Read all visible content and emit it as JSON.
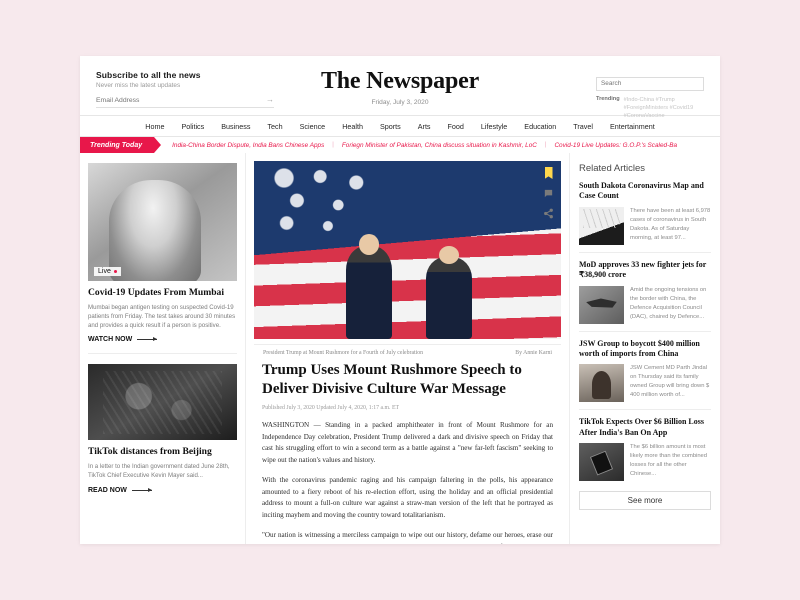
{
  "subscribe": {
    "title": "Subscribe to all the news",
    "subtitle": "Never miss the latest updates",
    "email_placeholder": "Email Address",
    "submit_arrow": "→"
  },
  "brand": {
    "title": "The Newspaper",
    "date": "Friday, July 3, 2020"
  },
  "search": {
    "placeholder": "Search",
    "trending_label": "Trending",
    "trending_tags": "#Indo-China #Trump #ForeignMinisters #Covid19 #CoronaVaccine"
  },
  "nav": {
    "items": [
      {
        "label": "Home"
      },
      {
        "label": "Politics"
      },
      {
        "label": "Business"
      },
      {
        "label": "Tech"
      },
      {
        "label": "Science"
      },
      {
        "label": "Health"
      },
      {
        "label": "Sports"
      },
      {
        "label": "Arts"
      },
      {
        "label": "Food"
      },
      {
        "label": "Lifestyle"
      },
      {
        "label": "Education"
      },
      {
        "label": "Travel"
      },
      {
        "label": "Entertainment"
      }
    ]
  },
  "ticker": {
    "badge": "Trending Today",
    "separator": "|",
    "items": [
      {
        "text": "India-China Border Dispute, India Bans Chinese Apps"
      },
      {
        "text": "Foriegn Minister of Pakistan, China discuss situation in Kashmir, LoC"
      },
      {
        "text": "Covid-19 Live Updates: G.O.P.'s Scaled-Ba"
      }
    ]
  },
  "left_column": {
    "cards": [
      {
        "badge": "Live",
        "title": "Covid-19 Updates From Mumbai",
        "description": "Mumbai began antigen testing on suspected Covid-19 patients from Friday. The test takes around 30 minutes and provides a quick result if a person is positive.",
        "cta": "WATCH NOW"
      },
      {
        "title": "TikTok distances from Beijing",
        "description": "In a letter to the Indian government dated June 28th, TikTok Chief Executive Kevin Mayer said...",
        "cta": "READ NOW"
      }
    ]
  },
  "main_article": {
    "caption": "President Trump at Mount Rushmore for a Fourth of July celebration",
    "credit": "By Annie Karni",
    "headline": "Trump Uses Mount Rushmore Speech to Deliver Divisive Culture War Message",
    "meta": "Published July 3, 2020   Updated July 4, 2020, 1:17 a.m. ET",
    "paragraphs": [
      "WASHINGTON — Standing in a packed amphitheater in front of Mount Rushmore for an Independence Day celebration, President Trump delivered a dark and divisive speech on Friday that cast his struggling effort to win a second term as a battle against a \"new far-left fascism\" seeking to wipe out the nation's values and history.",
      "With the coronavirus pandemic raging and his campaign faltering in the polls, his appearance amounted to a fiery reboot of his re-election effort, using the holiday and an official presidential address to mount a full-on culture war against a straw-man version of the left that he portrayed as inciting mayhem and moving the country toward totalitarianism.",
      "\"Our nation is witnessing a merciless campaign to wipe out our history, defame our heroes, erase our values and indoctrinate our children,\" Mr. Trump said, addressing a packed crowd of sign-waving"
    ],
    "prev_label": "‹",
    "next_label": "›",
    "scroll_label": "⌄"
  },
  "related": {
    "title": "Related Articles",
    "see_more": "See more",
    "items": [
      {
        "headline": "South Dakota Coronavirus Map and Case Count",
        "description": "There have been at least 6,978 cases of coronavirus in South Dakota. As of Saturday morning, at least 97..."
      },
      {
        "headline": "MoD approves 33 new fighter jets for ₹38,900 crore",
        "description": "Amid the ongoing tensions on the border with China, the Defence Acquisition Council (DAC), chaired by Defence..."
      },
      {
        "headline": "JSW Group to boycott $400 million worth of imports from China",
        "description": "JSW Cement MD Parth Jindal on Thursday said its family owned Group will bring down $ 400 million worth of..."
      },
      {
        "headline": "TikTok Expects Over $6 Billion Loss After India's Ban On App",
        "description": "The $6 billion amount is most likely more than the combined losses for all the other Chinese..."
      }
    ]
  },
  "colors": {
    "accent_red": "#e8174a",
    "page_background": "#f7e9ed",
    "bookmark_yellow": "#ffd84d"
  }
}
